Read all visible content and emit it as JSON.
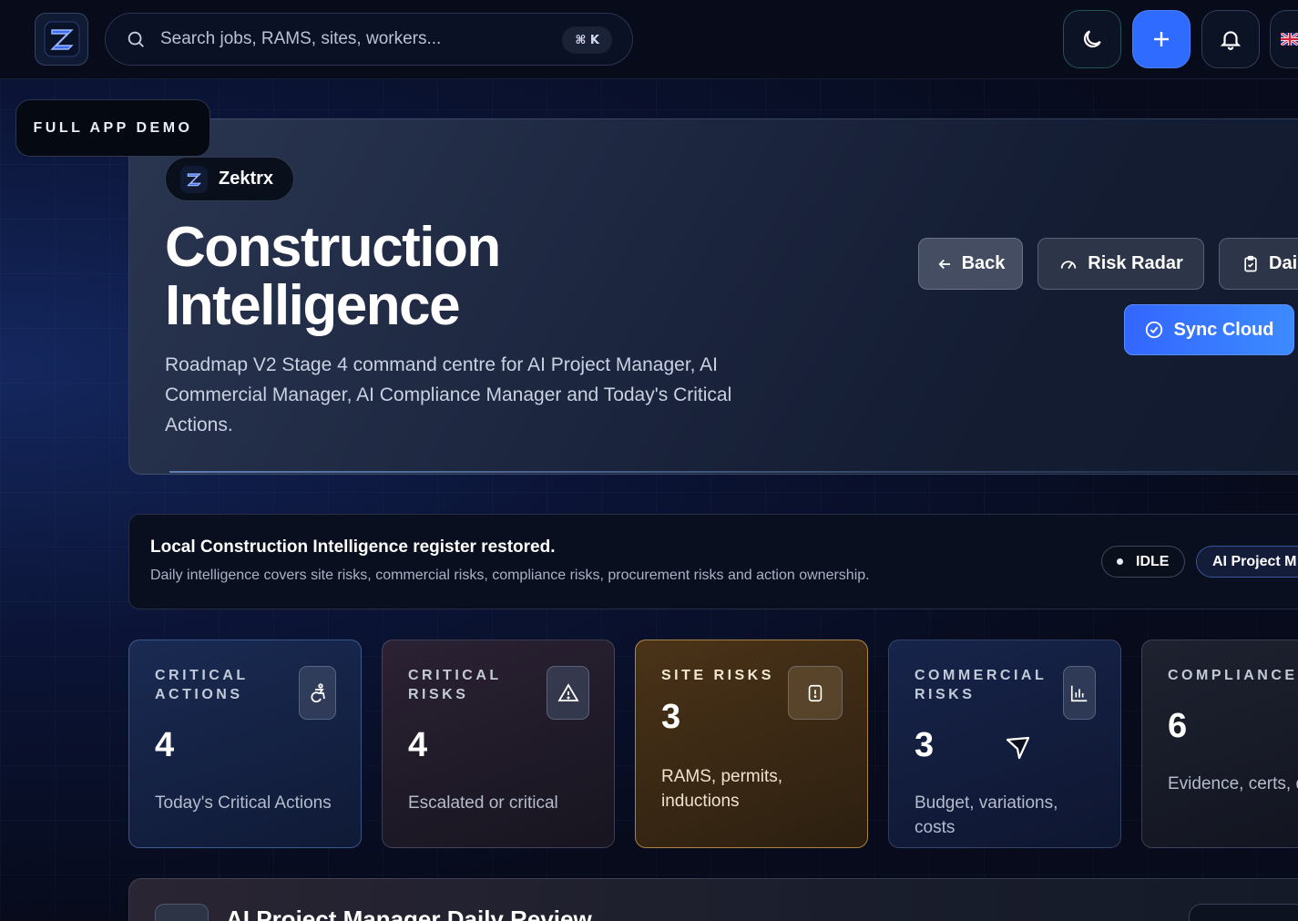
{
  "search": {
    "placeholder": "Search jobs, RAMS, sites, workers...",
    "shortcut": "⌘ K"
  },
  "badge": {
    "label": "FULL APP DEMO"
  },
  "brand": {
    "name": "Zektrx"
  },
  "hero": {
    "title": "Construction Intelligence",
    "subtitle": "Roadmap V2 Stage 4 command centre for AI Project Manager, AI Commercial Manager, AI Compliance Manager and Today's Critical Actions.",
    "buttons": {
      "back": "Back",
      "risk_radar": "Risk Radar",
      "daily": "Dai",
      "sync": "Sync Cloud"
    }
  },
  "status": {
    "title": "Local Construction Intelligence register restored.",
    "description": "Daily intelligence covers site risks, commercial risks, compliance risks, procurement risks and action ownership.",
    "state": "IDLE",
    "mode": "AI Project M"
  },
  "cards": [
    {
      "label": "CRITICAL ACTIONS",
      "value": "4",
      "desc": "Today's Critical Actions",
      "icon": "accessibility-icon"
    },
    {
      "label": "CRITICAL RISKS",
      "value": "4",
      "desc": "Escalated or critical",
      "icon": "warning-icon"
    },
    {
      "label": "SITE RISKS",
      "value": "3",
      "desc": "RAMS, permits, inductions",
      "icon": "alert-file-icon"
    },
    {
      "label": "COMMERCIAL RISKS",
      "value": "3",
      "desc": "Budget, variations, costs",
      "icon": "bar-chart-icon"
    },
    {
      "label": "COMPLIANCE PROCUREMEN",
      "value": "6",
      "desc": "Evidence, certs, delivery",
      "icon": ""
    }
  ],
  "section": {
    "title": "AI Project Manager Daily Review"
  },
  "colors": {
    "accent": "#2f6bff",
    "site_risk": "#e0a856"
  }
}
